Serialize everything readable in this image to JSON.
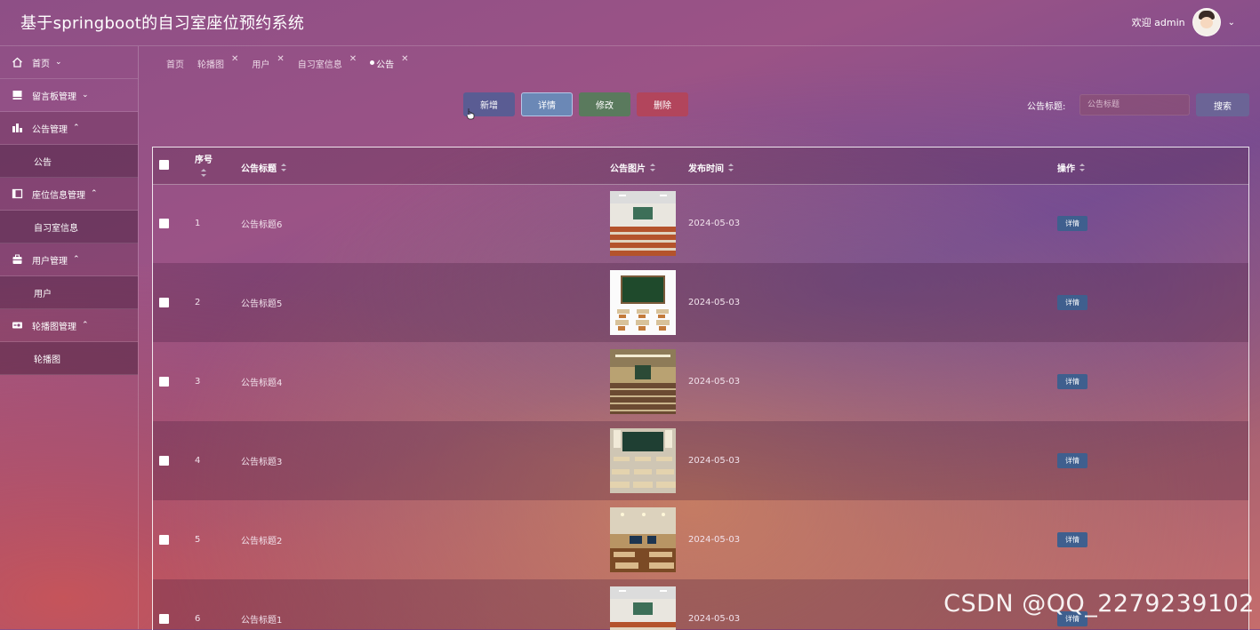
{
  "header": {
    "title": "基于springboot的自习室座位预约系统",
    "welcome": "欢迎 admin"
  },
  "sidebar": {
    "items": [
      {
        "label": "首页",
        "icon": "home-icon",
        "expanded": false
      },
      {
        "label": "留言板管理",
        "icon": "message-board-icon",
        "expanded": false
      },
      {
        "label": "公告管理",
        "icon": "announcement-icon",
        "expanded": true,
        "children": [
          "公告"
        ]
      },
      {
        "label": "座位信息管理",
        "icon": "seat-icon",
        "expanded": true,
        "children": [
          "自习室信息"
        ]
      },
      {
        "label": "用户管理",
        "icon": "user-icon",
        "expanded": true,
        "children": [
          "用户"
        ]
      },
      {
        "label": "轮播图管理",
        "icon": "carousel-icon",
        "expanded": true,
        "children": [
          "轮播图"
        ]
      }
    ]
  },
  "tabs": [
    {
      "label": "首页",
      "closable": false,
      "current": false
    },
    {
      "label": "轮播图",
      "closable": true,
      "current": false
    },
    {
      "label": "用户",
      "closable": true,
      "current": false
    },
    {
      "label": "自习室信息",
      "closable": true,
      "current": false
    },
    {
      "label": "公告",
      "closable": true,
      "current": true
    }
  ],
  "toolbar": {
    "add_label": "新增",
    "detail_label": "详情",
    "edit_label": "修改",
    "delete_label": "删除",
    "search_label": "公告标题:",
    "search_placeholder": "公告标题",
    "search_button": "搜索"
  },
  "table": {
    "columns": [
      "序号",
      "公告标题",
      "公告图片",
      "发布时间",
      "操作"
    ],
    "rows": [
      {
        "index": "1",
        "title": "公告标题6",
        "image": "lecture-hall-photo",
        "date": "2024-05-03",
        "action": "详情"
      },
      {
        "index": "2",
        "title": "公告标题5",
        "image": "classroom-desks-photo",
        "date": "2024-05-03",
        "action": "详情"
      },
      {
        "index": "3",
        "title": "公告标题4",
        "image": "auditorium-photo",
        "date": "2024-05-03",
        "action": "详情"
      },
      {
        "index": "4",
        "title": "公告标题3",
        "image": "classroom-photo",
        "date": "2024-05-03",
        "action": "详情"
      },
      {
        "index": "5",
        "title": "公告标题2",
        "image": "study-room-photo",
        "date": "2024-05-03",
        "action": "详情"
      },
      {
        "index": "6",
        "title": "公告标题1",
        "image": "lecture-hall-photo",
        "date": "2024-05-03",
        "action": "详情"
      }
    ]
  },
  "watermark": "CSDN @QQ_2279239102",
  "colors": {
    "add": "#5a5c93",
    "detail": "#6b88b6",
    "edit": "#5a7a5d",
    "delete": "#b2455c",
    "row_action": "#3f5f8e"
  }
}
